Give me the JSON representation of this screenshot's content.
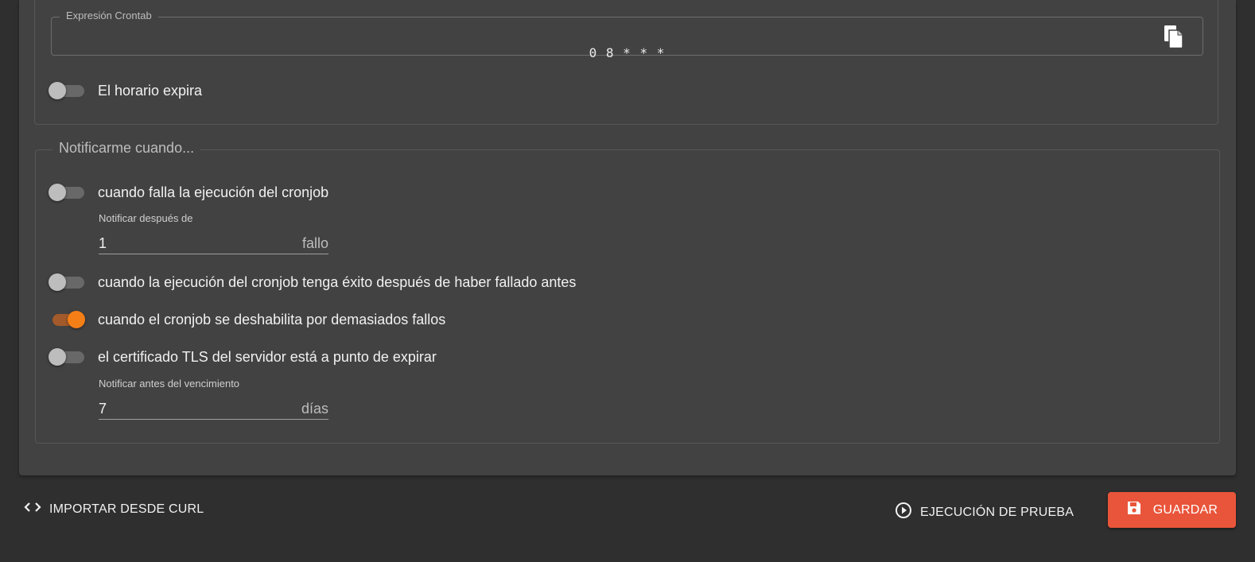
{
  "schedule": {
    "crontab_label": "Expresión Crontab",
    "crontab_value": "0 8 * * *",
    "expires_label": "El horario expira",
    "expires_on": false
  },
  "notify": {
    "legend": "Notificarme cuando...",
    "on_failure": {
      "label": "cuando falla la ejecución del cronjob",
      "on": false,
      "after_label": "Notificar después de",
      "after_value": "1",
      "after_unit": "fallo"
    },
    "on_success_after_failure": {
      "label": "cuando la ejecución del cronjob tenga éxito después de haber fallado antes",
      "on": false
    },
    "on_disabled": {
      "label": "cuando el cronjob se deshabilita por demasiados fallos",
      "on": true
    },
    "tls_expiry": {
      "label": "el certificado TLS del servidor está a punto de expirar",
      "on": false,
      "before_label": "Notificar antes del vencimiento",
      "before_value": "7",
      "before_unit": "días"
    }
  },
  "footer": {
    "import_label": "IMPORTAR DESDE CURL",
    "test_run_label": "EJECUCIÓN DE PRUEBA",
    "save_label": "GUARDAR"
  },
  "colors": {
    "accent": "#f57f17",
    "save": "#e9553a",
    "background": "#2f2f2f",
    "card": "#424242"
  },
  "icons": {
    "copy": "copy-icon",
    "code": "code-icon",
    "play": "play-circle-icon",
    "save": "floppy-disk-icon"
  }
}
